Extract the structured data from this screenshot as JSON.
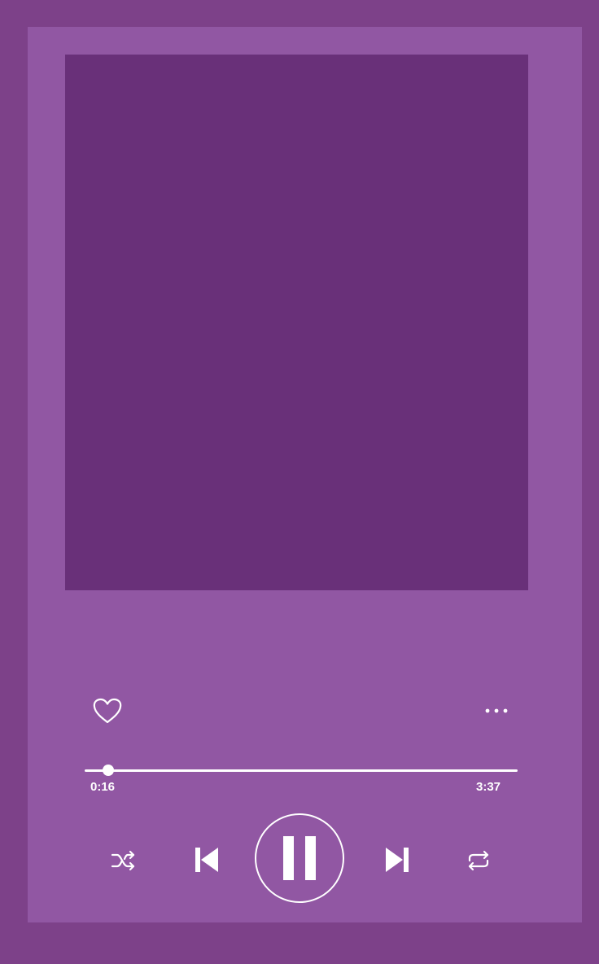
{
  "colors": {
    "background": "#7d4189",
    "card": "#9157a3",
    "album_art": "#693079",
    "foreground": "#ffffff"
  },
  "player": {
    "elapsed": "0:16",
    "duration": "3:37",
    "progress_fraction": 0.054,
    "state": "playing"
  },
  "icons": {
    "like": "heart-icon",
    "more": "more-dots-icon",
    "shuffle": "shuffle-icon",
    "previous": "skip-previous-icon",
    "play_pause": "pause-icon",
    "next": "skip-next-icon",
    "repeat": "repeat-icon"
  }
}
